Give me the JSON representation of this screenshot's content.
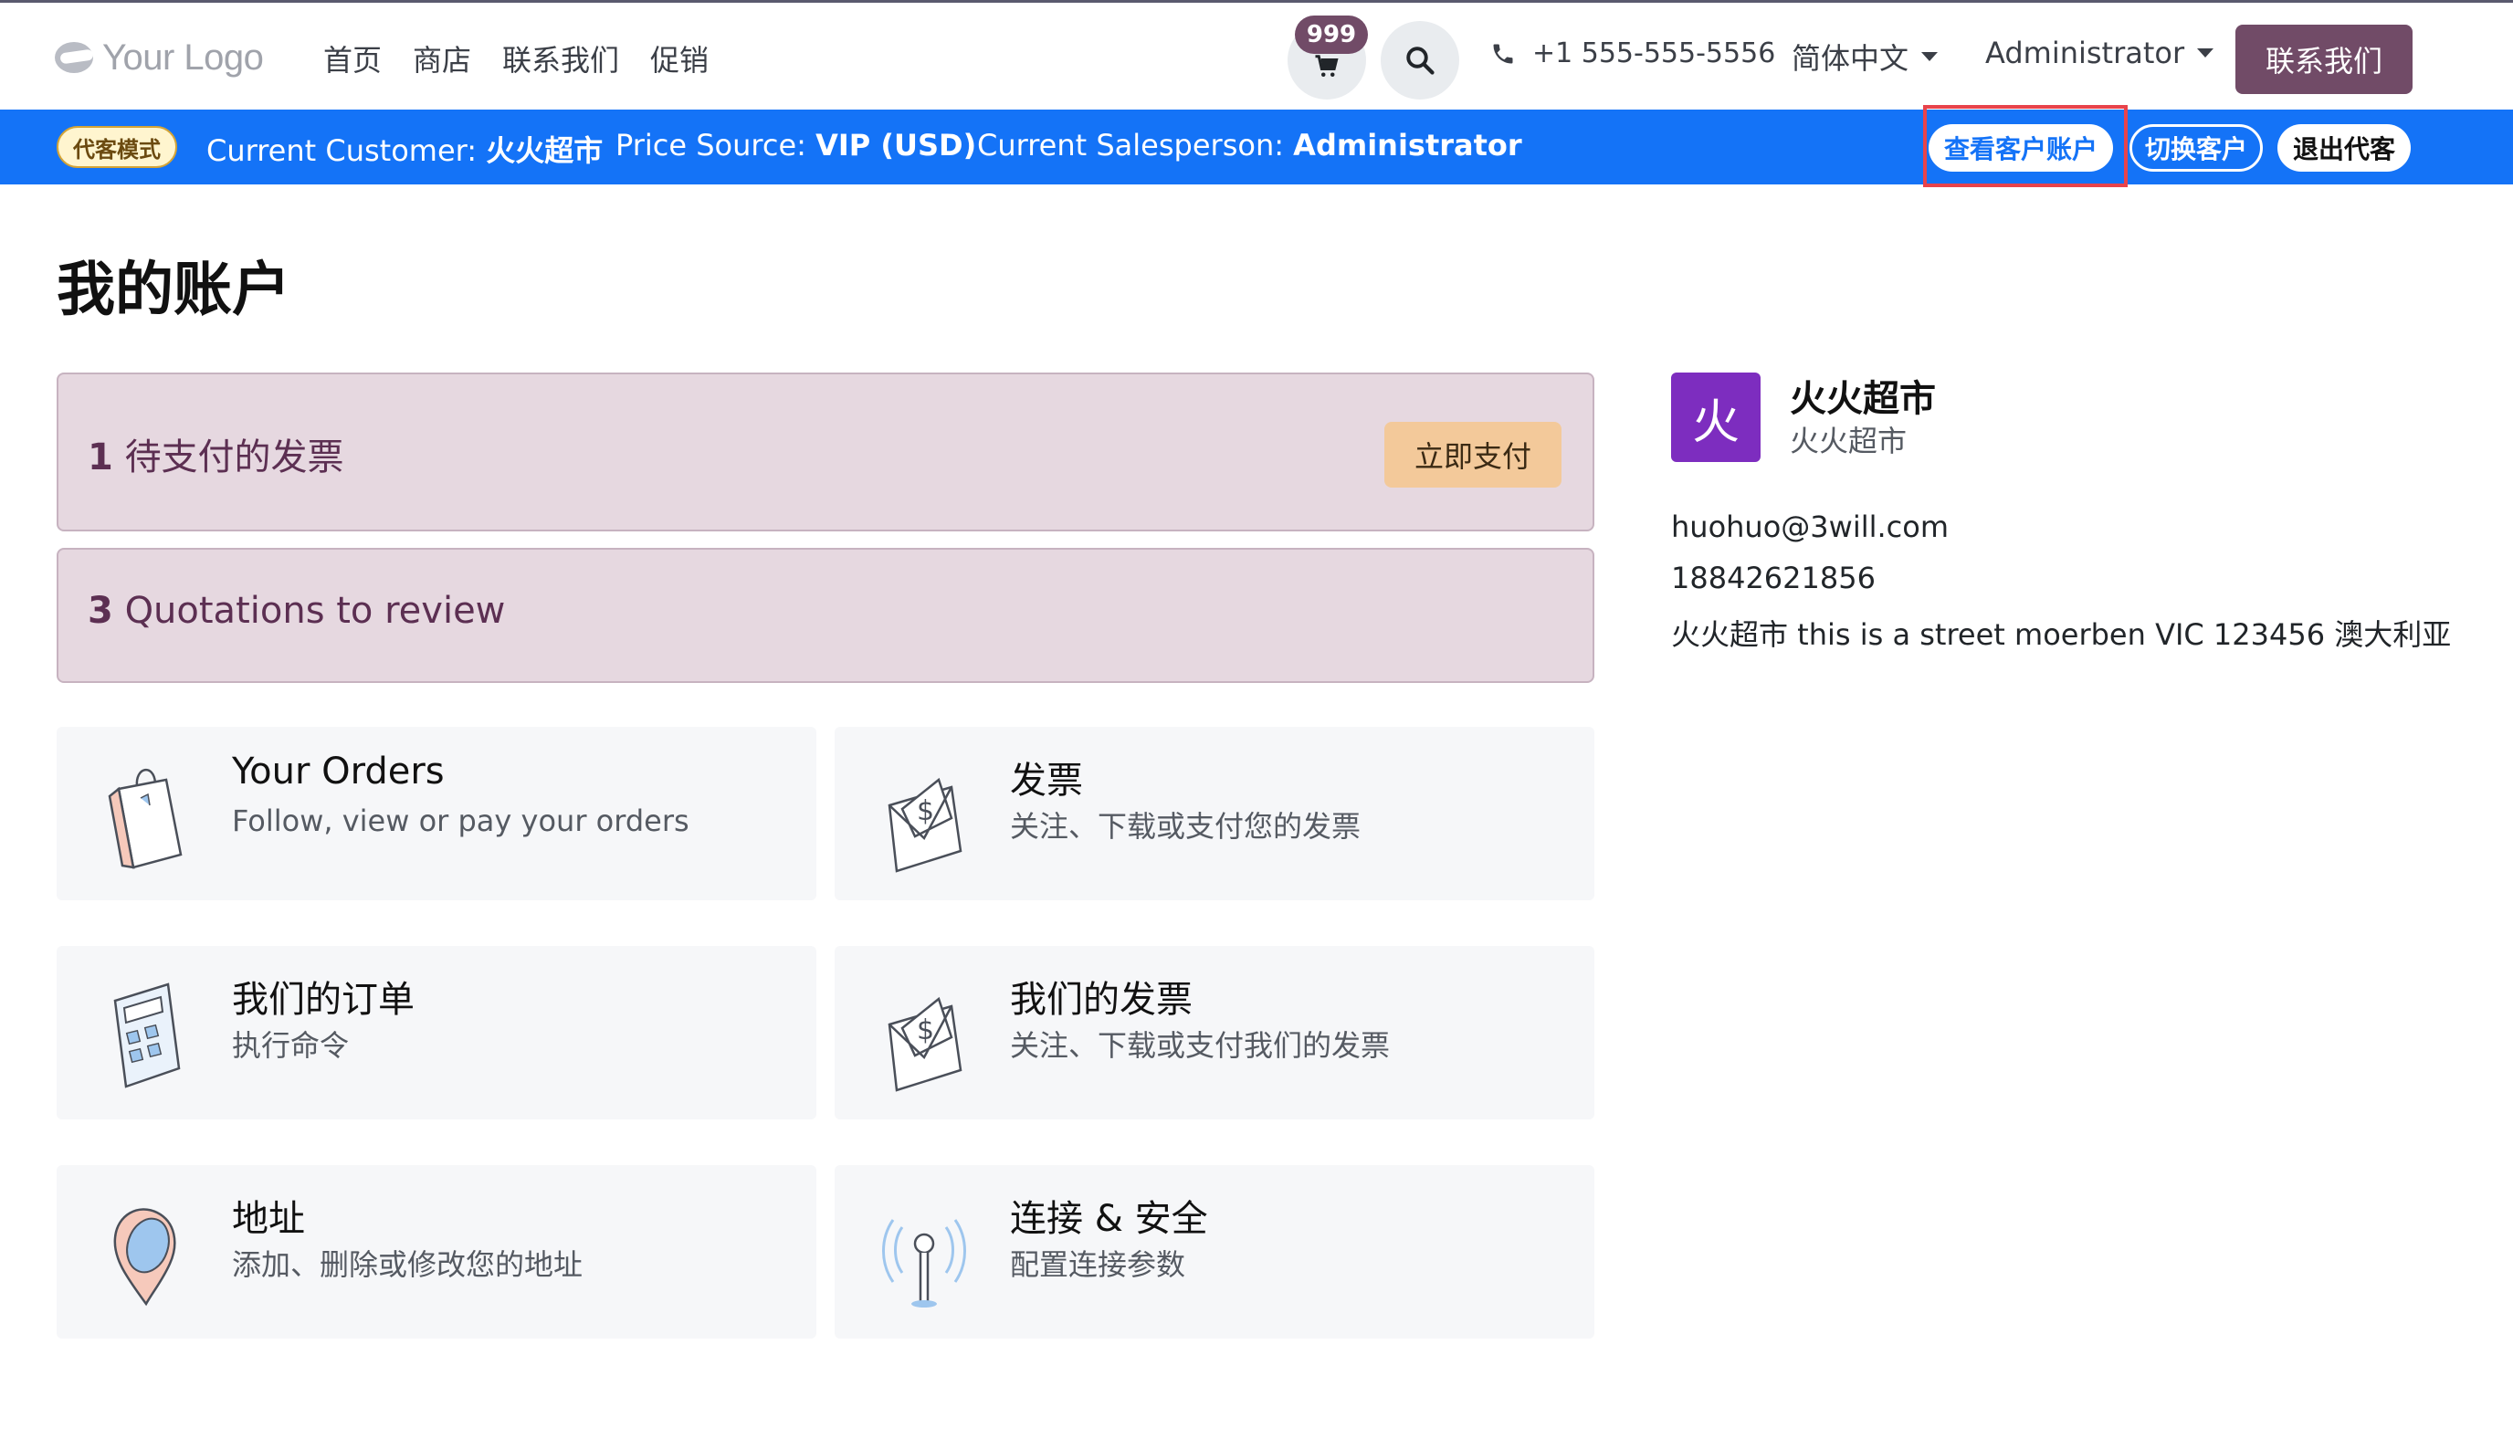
{
  "logo": {
    "text": "Your Logo"
  },
  "nav": {
    "items": [
      {
        "label": "首页"
      },
      {
        "label": "商店"
      },
      {
        "label": "联系我们"
      },
      {
        "label": "促销"
      }
    ]
  },
  "header": {
    "cart_count": "999",
    "phone": "+1 555-555-5556",
    "language": "简体中文",
    "user": "Administrator",
    "contact_button": "联系我们"
  },
  "impersonation_bar": {
    "mode_badge": "代客模式",
    "customer_label": "Current Customer:",
    "customer_value": "火火超市",
    "price_label": "Price Source:",
    "price_value": "VIP (USD)",
    "salesperson_label": "Current Salesperson:",
    "salesperson_value": "Administrator",
    "view_account_button": "查看客户账户",
    "switch_customer_button": "切换客户",
    "exit_button": "退出代客"
  },
  "page": {
    "title": "我的账户"
  },
  "alerts": {
    "invoices": {
      "count": "1",
      "text": "待支付的发票",
      "button": "立即支付"
    },
    "quotations": {
      "count": "3",
      "text": "Quotations to review"
    }
  },
  "cards": [
    {
      "title": "Your Orders",
      "subtitle": "Follow, view or pay your orders",
      "icon": "shopping-bag-icon"
    },
    {
      "title": "发票",
      "subtitle": "关注、下载或支付您的发票",
      "icon": "invoice-envelope-icon"
    },
    {
      "title": "我们的订单",
      "subtitle": "执行命令",
      "icon": "calculator-icon"
    },
    {
      "title": "我们的发票",
      "subtitle": "关注、下载或支付我们的发票",
      "icon": "invoice-envelope-icon"
    },
    {
      "title": "地址",
      "subtitle": "添加、删除或修改您的地址",
      "icon": "map-pin-icon"
    },
    {
      "title": "连接 & 安全",
      "subtitle": "配置连接参数",
      "icon": "antenna-icon"
    }
  ],
  "profile": {
    "avatar_letter": "火",
    "name": "火火超市",
    "company": "火火超市",
    "email": "huohuo@3will.com",
    "phone": "18842621856",
    "address": "火火超市 this is a street moerben VIC 123456 澳大利亚"
  },
  "colors": {
    "primary": "#714b67",
    "impersonation_bar": "#1473f7",
    "alert_bg": "#e6d8e0",
    "pay_button": "#f3c99a",
    "avatar": "#7d2dbf"
  }
}
